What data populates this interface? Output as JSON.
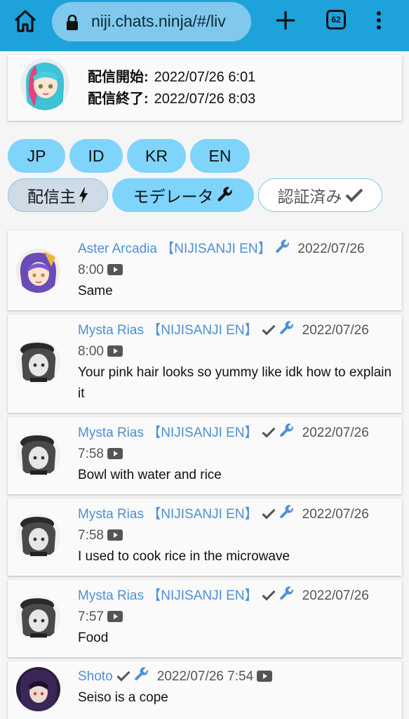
{
  "browser": {
    "url": "niji.chats.ninja/#/liv",
    "tab_count": "62"
  },
  "stream": {
    "start_label": "配信開始:",
    "start_value": "2022/07/26 6:01",
    "end_label": "配信終了:",
    "end_value": "2022/07/26 8:03"
  },
  "filters": {
    "languages": [
      "JP",
      "ID",
      "KR",
      "EN"
    ],
    "roles": {
      "streamer": "配信主",
      "moderator": "モデレータ",
      "verified": "認証済み"
    }
  },
  "messages": [
    {
      "author": "Aster Arcadia 【NIJISANJI EN】",
      "verified": false,
      "moderator": true,
      "time": "2022/07/26",
      "time2": "8:00",
      "text": "Same"
    },
    {
      "author": "Mysta Rias 【NIJISANJI EN】",
      "verified": true,
      "moderator": true,
      "time": "2022/07/26",
      "time2": "8:00",
      "text": "Your pink hair looks so yummy like idk how to explain it"
    },
    {
      "author": "Mysta Rias 【NIJISANJI EN】",
      "verified": true,
      "moderator": true,
      "time": "2022/07/26",
      "time2": "7:58",
      "text": "Bowl with water and rice"
    },
    {
      "author": "Mysta Rias 【NIJISANJI EN】",
      "verified": true,
      "moderator": true,
      "time": "2022/07/26",
      "time2": "7:58",
      "text": "I used to cook rice in the microwave"
    },
    {
      "author": "Mysta Rias 【NIJISANJI EN】",
      "verified": true,
      "moderator": true,
      "time": "2022/07/26",
      "time2": "7:57",
      "text": "Food"
    },
    {
      "author": "Shoto",
      "verified": true,
      "moderator": true,
      "time": "2022/07/26 7:54",
      "time2": "",
      "text": "Seiso is a cope"
    }
  ],
  "colors": {
    "browser_bar": "#1ea2dc",
    "chip_blue": "#7fd4fb",
    "author_blue": "#4d8fd6"
  }
}
